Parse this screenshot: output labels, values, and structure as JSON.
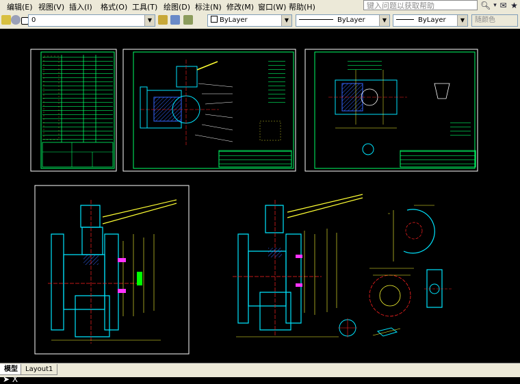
{
  "menu": {
    "items": [
      "编辑(E)",
      "视图(V)",
      "插入(I)",
      "格式(O)",
      "工具(T)",
      "绘图(D)",
      "标注(N)",
      "修改(M)",
      "窗口(W)",
      "帮助(H)"
    ],
    "search_placeholder": "键入问题以获取帮助"
  },
  "toolbar": {
    "layer_value": "0",
    "color_value": "ByLayer",
    "linetype_value": "ByLayer",
    "lineweight_value": "ByLayer",
    "plotstyle_value": "随颜色"
  },
  "tabs": {
    "model": "模型",
    "layout1": "Layout1"
  },
  "colors": {
    "frame": "#ffffff",
    "border": "#00ff66",
    "cyan": "#00e5ff",
    "yellow": "#ffff33",
    "red": "#ff2222",
    "magenta": "#ff33ff",
    "blue": "#3366ff",
    "green": "#00ff00"
  }
}
